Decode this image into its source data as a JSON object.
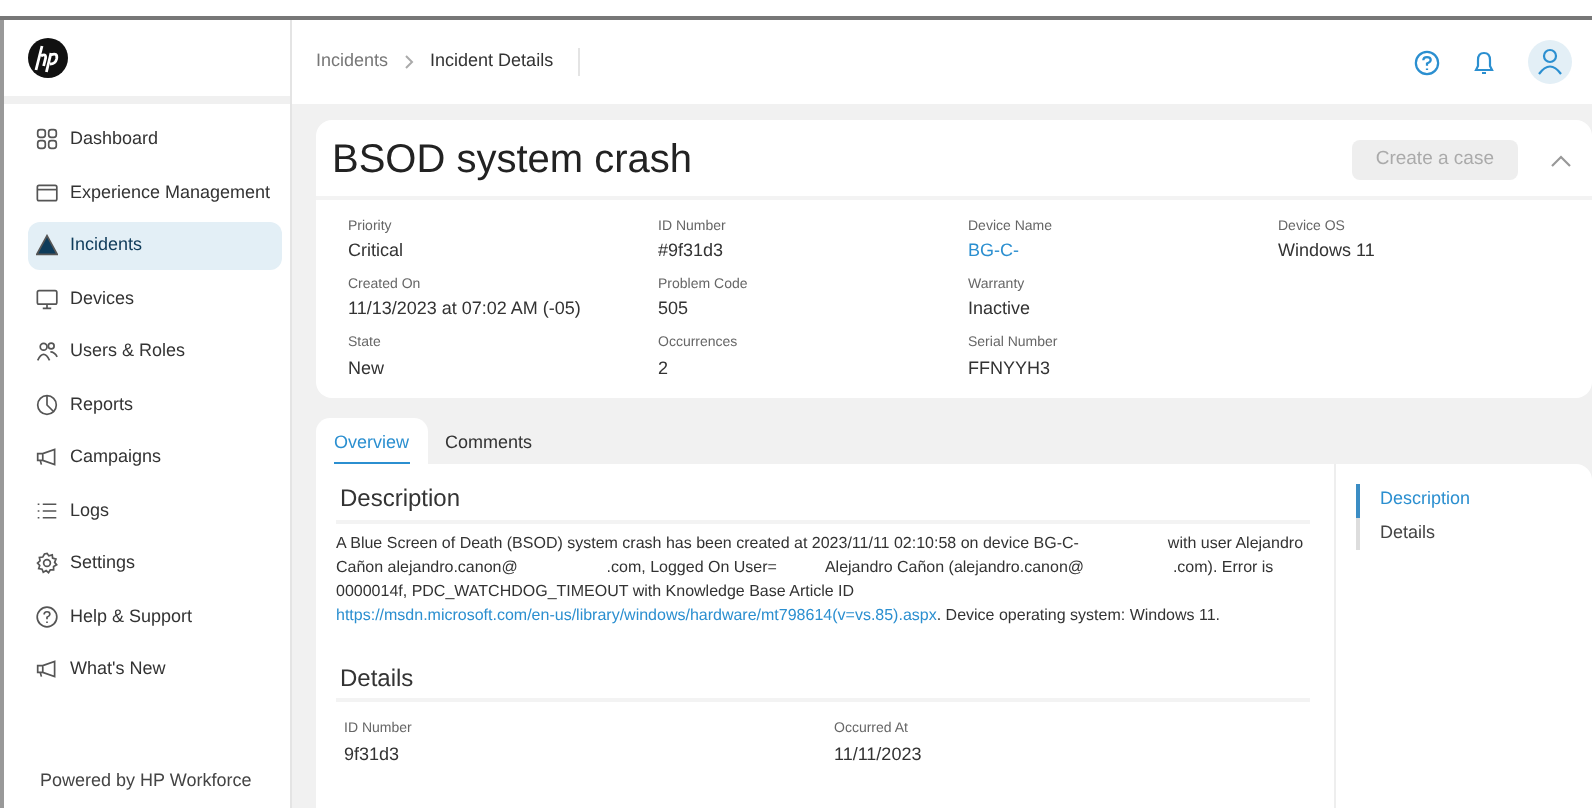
{
  "sidebar": {
    "items": [
      {
        "label": "Dashboard",
        "selected": false
      },
      {
        "label": "Experience Management",
        "selected": false
      },
      {
        "label": "Incidents",
        "selected": true
      },
      {
        "label": "Devices",
        "selected": false
      },
      {
        "label": "Users & Roles",
        "selected": false
      },
      {
        "label": "Reports",
        "selected": false
      },
      {
        "label": "Campaigns",
        "selected": false
      },
      {
        "label": "Logs",
        "selected": false
      },
      {
        "label": "Settings",
        "selected": false
      },
      {
        "label": "Help & Support",
        "selected": false
      },
      {
        "label": "What's New",
        "selected": false
      }
    ],
    "footer": "Powered by HP Workforce"
  },
  "breadcrumb": [
    "Incidents",
    "Incident Details"
  ],
  "incident": {
    "title": "BSOD system crash",
    "create_button": {
      "label": "Create a case",
      "disabled": true
    },
    "field_rows": [
      [
        {
          "label": "Priority",
          "value": "Critical",
          "kind": "text"
        },
        {
          "label": "ID Number",
          "value": "#9f31d3",
          "kind": "text"
        },
        {
          "label": "Device Name",
          "value": "BG-C-",
          "kind": "link"
        },
        {
          "label": "Device OS",
          "value": "Windows 11",
          "kind": "text"
        }
      ],
      [
        {
          "label": "Created On",
          "value": "11/13/2023 at 07:02 AM (-05)",
          "kind": "text"
        },
        {
          "label": "Problem Code",
          "value": "505",
          "kind": "text"
        },
        {
          "label": "Warranty",
          "value": "Inactive",
          "kind": "text"
        }
      ],
      [
        {
          "label": "State",
          "value": "New",
          "kind": "text"
        },
        {
          "label": "Occurrences",
          "value": "2",
          "kind": "text"
        },
        {
          "label": "Serial Number",
          "value": "FFNYYH3",
          "kind": "text"
        }
      ]
    ]
  },
  "tabs": [
    {
      "label": "Overview",
      "selected": true
    },
    {
      "label": "Comments",
      "selected": false
    }
  ],
  "description": {
    "heading": "Description",
    "text_before": "A Blue Screen of Death (BSOD) system crash has been created at 2023/11/11 02:10:58 on device BG-C-                    with user Alejandro Cañon alejandro.canon@                    .com, Logged On User=           Alejandro Cañon (alejandro.canon@                    .com). Error is 0000014f, PDC_WATCHDOG_TIMEOUT with Knowledge Base Article ID ",
    "link": "https://msdn.microsoft.com/en-us/library/windows/hardware/mt798614(v=vs.85).aspx",
    "text_after": ". Device operating system: Windows 11."
  },
  "details": {
    "heading": "Details",
    "fields": [
      {
        "label": "ID Number",
        "value": "9f31d3"
      },
      {
        "label": "Occurred At",
        "value": "11/11/2023"
      }
    ]
  },
  "page_nav": [
    {
      "label": "Description",
      "selected": true
    },
    {
      "label": "Details",
      "selected": false
    }
  ]
}
